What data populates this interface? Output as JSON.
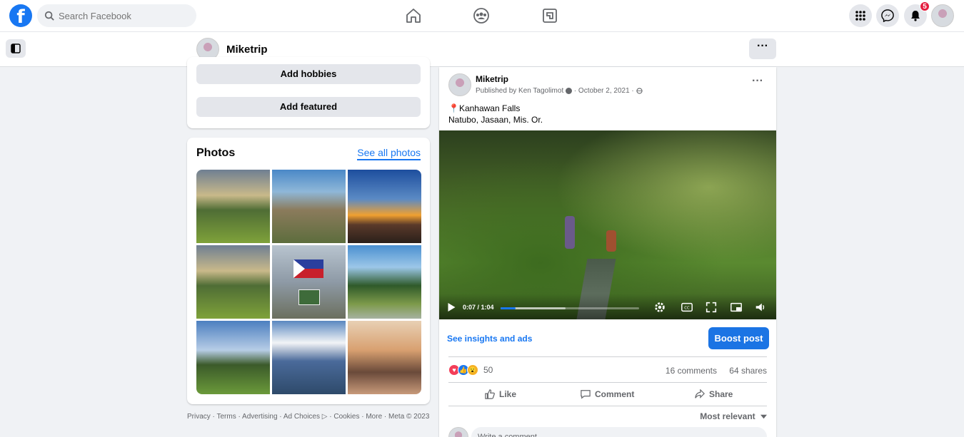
{
  "topbar": {
    "logo": "f",
    "search_placeholder": "Search Facebook",
    "nav_icons": [
      "home-icon",
      "groups-icon",
      "gaming-icon"
    ],
    "right_icons": [
      "menu-grid-icon",
      "messenger-icon",
      "notifications-icon"
    ],
    "notification_count": "5"
  },
  "page_header": {
    "name": "Miketrip",
    "more_label": "···"
  },
  "intro_card": {
    "add_hobbies": "Add hobbies",
    "add_featured": "Add featured"
  },
  "photos_card": {
    "title": "Photos",
    "see_all": "See all photos",
    "photo_count": 9
  },
  "footer": {
    "links": "Privacy · Terms · Advertising · Ad Choices ▷ · Cookies · More · Meta © 2023"
  },
  "post": {
    "author": "Miketrip",
    "published_by": "Published by Ken Tagolimot",
    "date": "October 2, 2021",
    "menu_label": "···",
    "text_line1": "📍Kanhawan Falls",
    "text_line2": "Natubo, Jasaan, Mis. Or.",
    "video": {
      "time": "0:07 / 1:04",
      "elapsed_seconds": 7,
      "duration_seconds": 64,
      "buffered_fraction": 0.47
    },
    "insights_label": "See insights and ads",
    "boost_label": "Boost post",
    "reaction_count": "50",
    "comments_count": "16 comments",
    "shares_count": "64 shares",
    "actions": {
      "like": "Like",
      "comment": "Comment",
      "share": "Share"
    },
    "sort_label": "Most relevant",
    "comment_placeholder": "Write a comment..."
  },
  "colors": {
    "brand_blue": "#1877f2",
    "background": "#f0f2f5",
    "badge_red": "#e41e3f"
  }
}
